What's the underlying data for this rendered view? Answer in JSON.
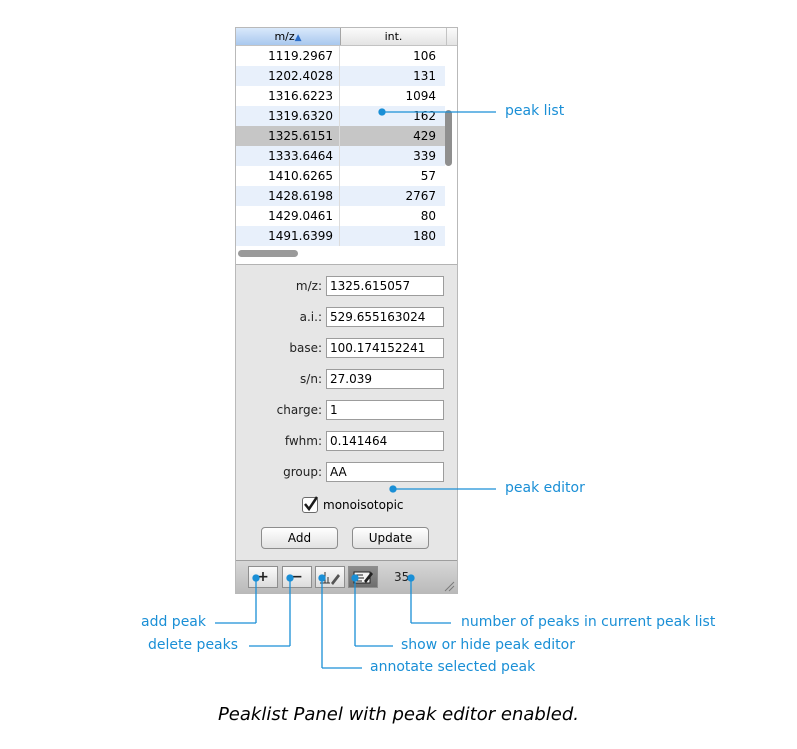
{
  "table": {
    "col_mz": "m/z",
    "col_int": "int.",
    "rows": [
      {
        "mz": "1119.2967",
        "int": "106"
      },
      {
        "mz": "1202.4028",
        "int": "131"
      },
      {
        "mz": "1316.6223",
        "int": "1094"
      },
      {
        "mz": "1319.6320",
        "int": "162"
      },
      {
        "mz": "1325.6151",
        "int": "429"
      },
      {
        "mz": "1333.6464",
        "int": "339"
      },
      {
        "mz": "1410.6265",
        "int": "57"
      },
      {
        "mz": "1428.6198",
        "int": "2767"
      },
      {
        "mz": "1429.0461",
        "int": "80"
      },
      {
        "mz": "1491.6399",
        "int": "180"
      }
    ],
    "selected_index": 4
  },
  "editor": {
    "fields": [
      {
        "label": "m/z:",
        "value": "1325.615057"
      },
      {
        "label": "a.i.:",
        "value": "529.655163024"
      },
      {
        "label": "base:",
        "value": "100.174152241"
      },
      {
        "label": "s/n:",
        "value": "27.039"
      },
      {
        "label": "charge:",
        "value": "1"
      },
      {
        "label": "fwhm:",
        "value": "0.141464"
      },
      {
        "label": "group:",
        "value": "AA"
      }
    ],
    "monoisotopic_label": "monoisotopic",
    "monoisotopic_checked": true,
    "add_label": "Add",
    "update_label": "Update"
  },
  "toolbar": {
    "add_symbol": "+",
    "delete_symbol": "−",
    "peak_count": "35"
  },
  "callouts": {
    "peak_list": "peak list",
    "peak_editor": "peak editor",
    "add_peak": "add peak",
    "delete_peaks": "delete peaks",
    "annotate": "annotate selected peak",
    "show_hide": "show or hide peak editor",
    "count": "number of peaks in current peak list"
  },
  "caption": "Peaklist Panel with peak editor enabled.",
  "colors": {
    "accent": "#1a8fd6",
    "selected_row": "#c6c6c6",
    "alt_row": "#e8f0fb"
  }
}
